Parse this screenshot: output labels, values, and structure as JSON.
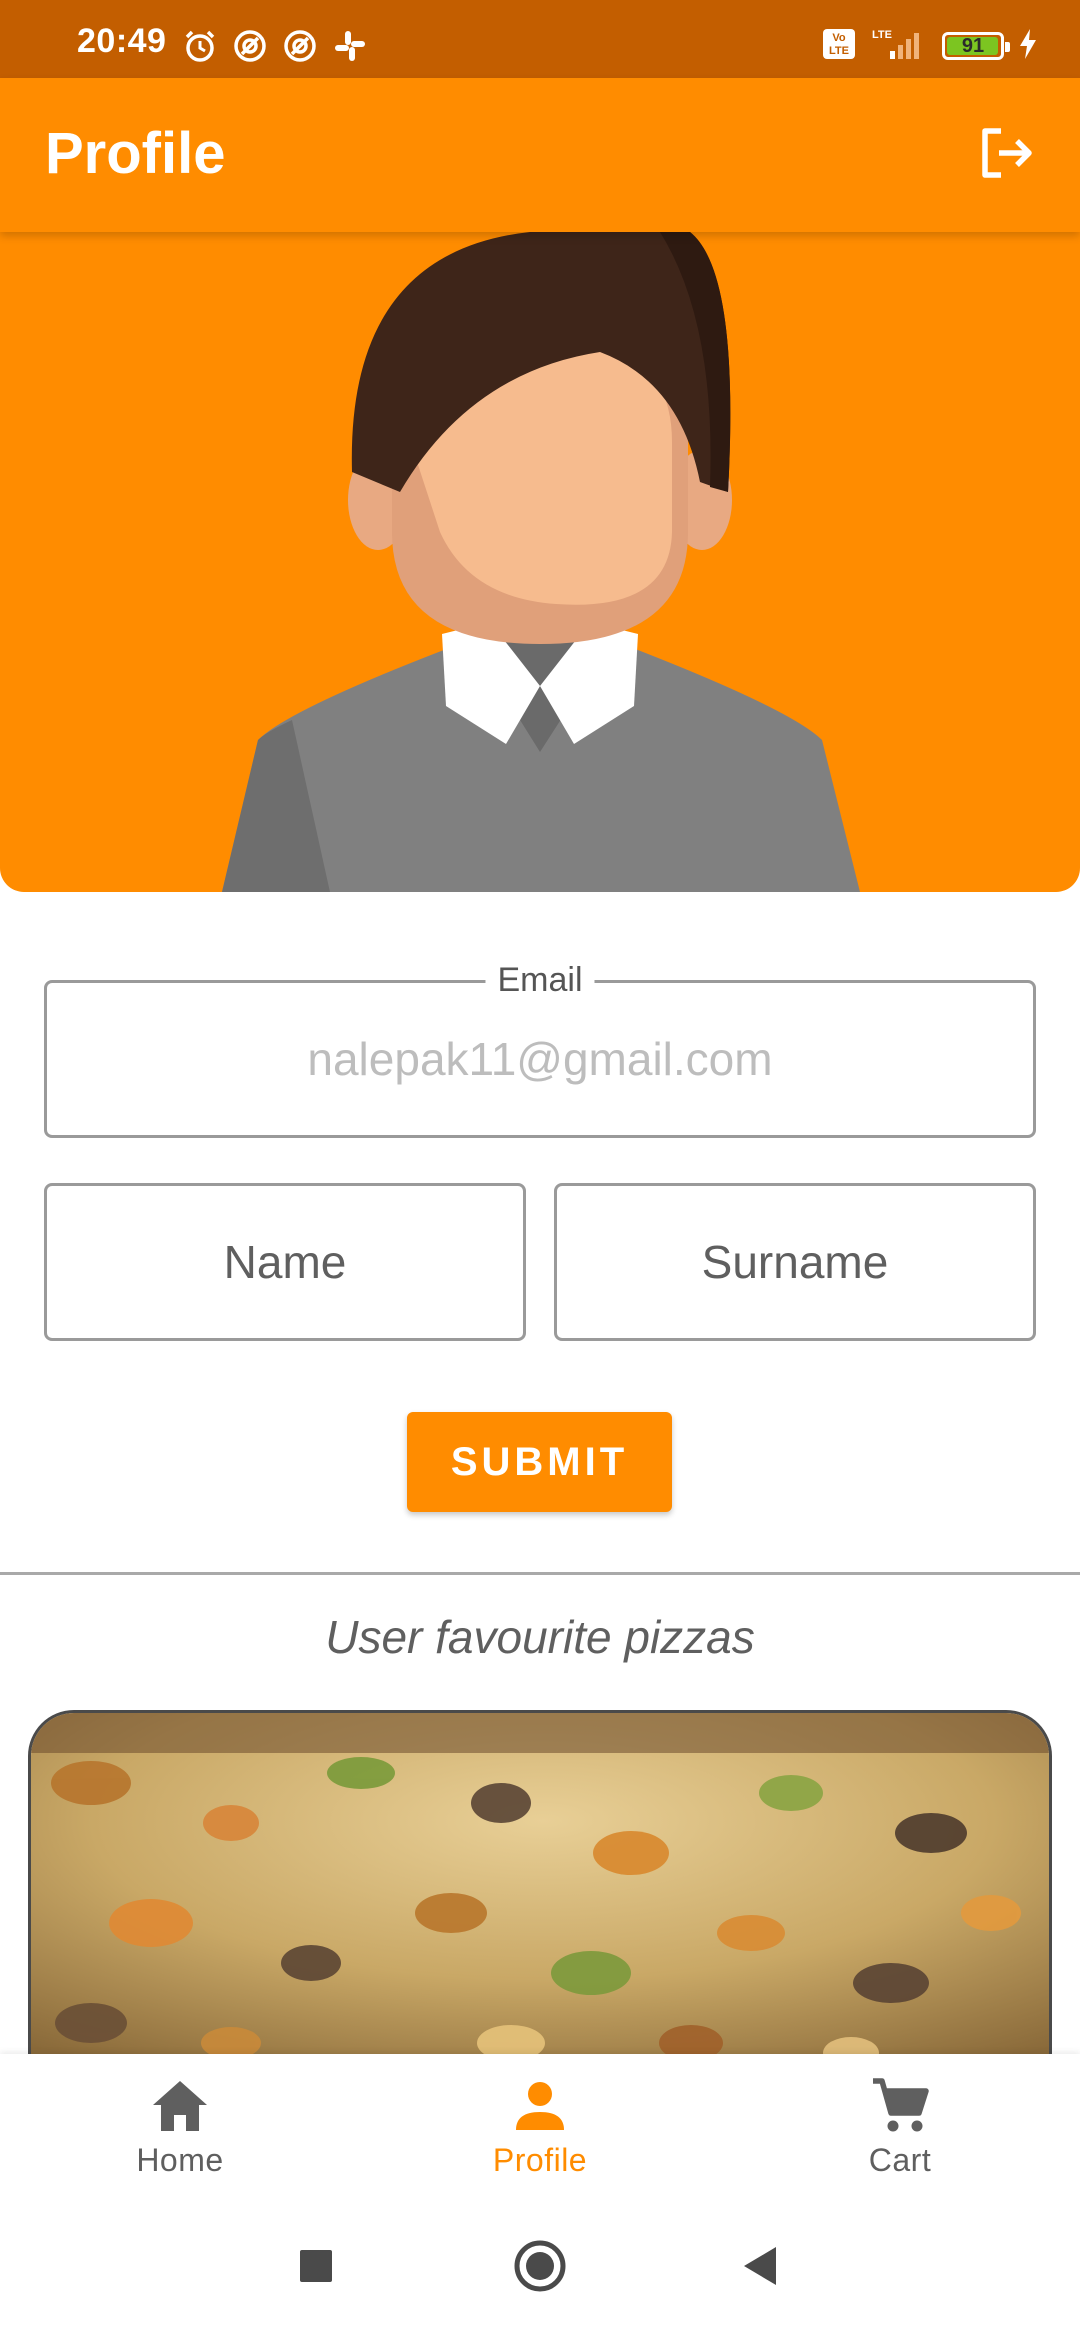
{
  "status_bar": {
    "time": "20:49",
    "battery_level": "91",
    "network": "LTE",
    "left_icons": [
      "alarm-icon",
      "app-notification-icon",
      "app-notification-icon",
      "slack-icon"
    ],
    "right_icons": [
      "volte-icon",
      "signal-icon",
      "battery-icon",
      "charging-icon"
    ]
  },
  "app_bar": {
    "title": "Profile",
    "action_icon": "logout-icon"
  },
  "form": {
    "email": {
      "label": "Email",
      "value": "nalepak11@gmail.com"
    },
    "name": {
      "placeholder": "Name"
    },
    "surname": {
      "placeholder": "Surname"
    },
    "submit_label": "SUBMIT"
  },
  "favourites": {
    "title": "User favourite pizzas"
  },
  "bottom_nav": {
    "items": [
      {
        "label": "Home",
        "icon": "home-icon",
        "active": false
      },
      {
        "label": "Profile",
        "icon": "person-icon",
        "active": true
      },
      {
        "label": "Cart",
        "icon": "cart-icon",
        "active": false
      }
    ]
  },
  "colors": {
    "primary": "#ff8c00",
    "status_bar": "#c35e00",
    "text": "#5f5f5f",
    "placeholder": "#bdbdbd"
  }
}
